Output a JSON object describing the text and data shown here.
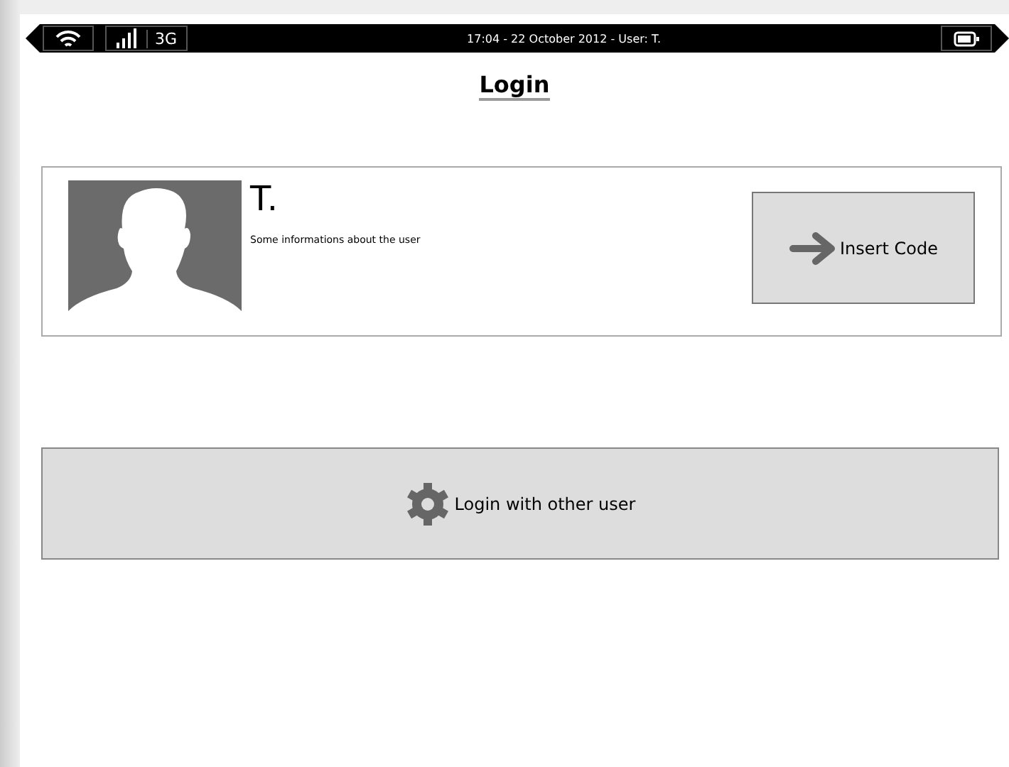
{
  "status_bar": {
    "network": "3G",
    "info": "17:04 - 22 October 2012 - User: T."
  },
  "title": "Login",
  "user_card": {
    "name": "T.",
    "description": "Some informations about the user",
    "action": "Insert Code"
  },
  "other_user_button": "Login with other user"
}
